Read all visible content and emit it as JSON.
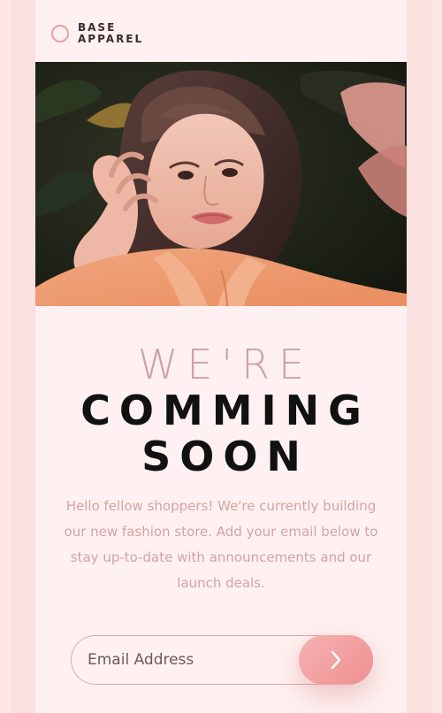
{
  "brand": {
    "line1": "BASE",
    "line2": "APPAREL",
    "logo_icon": "circle-outline-icon",
    "accent_color": "#f19c9c"
  },
  "hero": {
    "image": "portrait-photo"
  },
  "headline": {
    "light": "WE'RE",
    "dark_line1": "COMMING",
    "dark_line2": "SOON"
  },
  "description": "Hello fellow shoppers! We're currently building our new fashion store. Add your email below to stay up-to-date with announcements and our launch deals.",
  "form": {
    "placeholder": "Email Address",
    "submit_icon": "chevron-right-icon"
  },
  "colors": {
    "background": "#fff1f1",
    "button_gradient_start": "#f6b2b2",
    "button_gradient_end": "#ee8f8f",
    "headline_light": "#cfa1a1",
    "headline_dark": "#111111",
    "body_text": "#d4a2a2"
  }
}
